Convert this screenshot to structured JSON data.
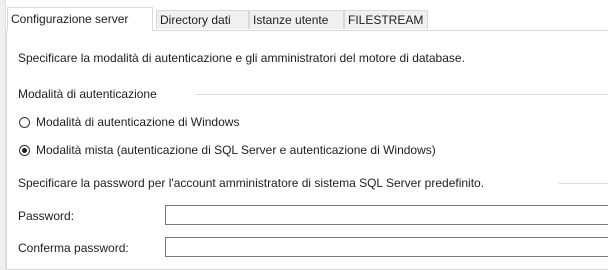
{
  "tabs": [
    {
      "label": "Configurazione server",
      "active": true
    },
    {
      "label": "Directory dati",
      "active": false
    },
    {
      "label": "Istanze utente",
      "active": false
    },
    {
      "label": "FILESTREAM",
      "active": false
    }
  ],
  "content": {
    "description": "Specificare la modalità di autenticazione e gli amministratori del motore di database.",
    "auth_group_label": "Modalità di autenticazione",
    "radio_windows_label": "Modalità di autenticazione di Windows",
    "radio_windows_selected": false,
    "radio_mixed_label": "Modalità mista (autenticazione di SQL Server e autenticazione di Windows)",
    "radio_mixed_selected": true,
    "password_section_label": "Specificare la password per l'account amministratore di sistema SQL Server predefinito.",
    "password_label": "Password:",
    "password_value": "",
    "confirm_label": "Conferma password:",
    "confirm_value": ""
  },
  "colors": {
    "border": "#d9d9d9",
    "tab_inactive_bg": "#f0f0f0",
    "input_border": "#7a7a7a"
  }
}
